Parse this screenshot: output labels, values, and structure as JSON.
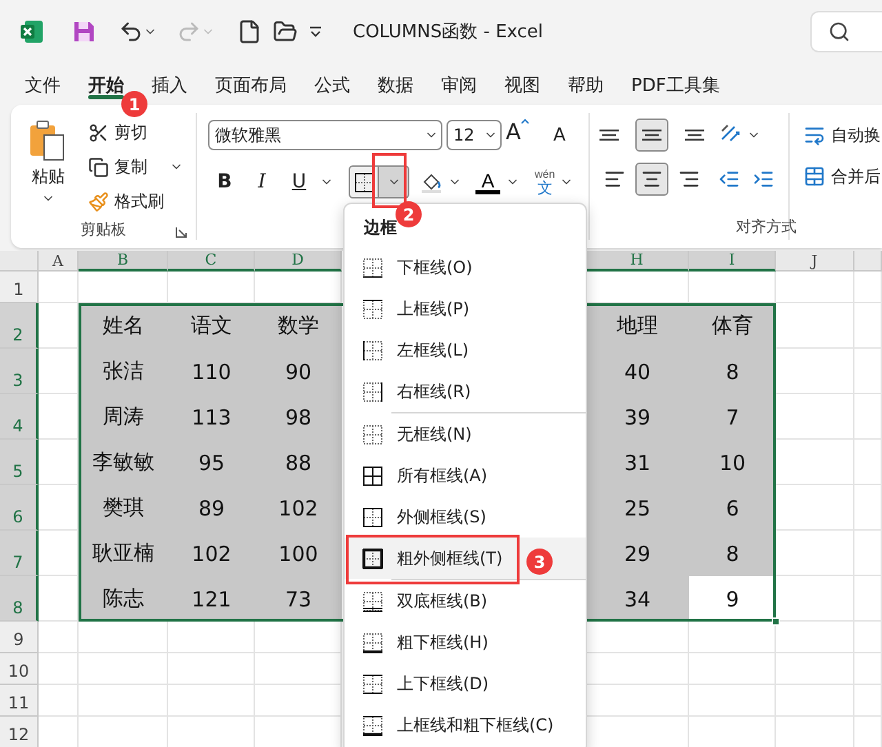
{
  "title_bar": {
    "title": "COLUMNS函数  -  Excel",
    "redo_disabled": true
  },
  "tabs": [
    {
      "label": "文件",
      "selected": false
    },
    {
      "label": "开始",
      "selected": true
    },
    {
      "label": "插入",
      "selected": false
    },
    {
      "label": "页面布局",
      "selected": false
    },
    {
      "label": "公式",
      "selected": false
    },
    {
      "label": "数据",
      "selected": false
    },
    {
      "label": "审阅",
      "selected": false
    },
    {
      "label": "视图",
      "selected": false
    },
    {
      "label": "帮助",
      "selected": false
    },
    {
      "label": "PDF工具集",
      "selected": false
    }
  ],
  "ribbon": {
    "clipboard": {
      "paste": "粘贴",
      "cut": "剪切",
      "copy": "复制",
      "format_painter": "格式刷",
      "label": "剪贴板"
    },
    "font": {
      "font_name": "微软雅黑",
      "font_size": "12",
      "grow": "A",
      "shrink": "A",
      "bold": "B",
      "italic": "I",
      "underline": "U",
      "font_color": "A",
      "phonetic_top": "wén",
      "phonetic_bottom": "文",
      "border_dropdown_pressed": true
    },
    "alignment": {
      "label": "对齐方式",
      "wrap_text": "自动换",
      "merge": "合并后",
      "vertical_align": [
        {
          "selected": false
        },
        {
          "selected": true
        },
        {
          "selected": false
        }
      ],
      "horizontal_align": [
        {
          "selected": false
        },
        {
          "selected": true
        },
        {
          "selected": false
        }
      ]
    }
  },
  "sheet": {
    "columns": [
      {
        "label": "A",
        "selected": false
      },
      {
        "label": "B",
        "selected": true
      },
      {
        "label": "C",
        "selected": true
      },
      {
        "label": "D",
        "selected": true
      },
      {
        "label": "H",
        "selected": true
      },
      {
        "label": "I",
        "selected": true
      },
      {
        "label": "J",
        "selected": false
      }
    ],
    "rows": [
      {
        "number": "1",
        "selected": false
      },
      {
        "number": "2",
        "selected": true
      },
      {
        "number": "3",
        "selected": true
      },
      {
        "number": "4",
        "selected": true
      },
      {
        "number": "5",
        "selected": true
      },
      {
        "number": "6",
        "selected": true
      },
      {
        "number": "7",
        "selected": true
      },
      {
        "number": "8",
        "selected": true
      },
      {
        "number": "9",
        "selected": false
      },
      {
        "number": "10",
        "selected": false
      },
      {
        "number": "11",
        "selected": false
      },
      {
        "number": "12",
        "selected": false
      }
    ],
    "table": [
      [
        {
          "text": "姓名",
          "active": false
        },
        {
          "text": "语文",
          "active": false
        },
        {
          "text": "数学",
          "active": false
        },
        {
          "text": "地理",
          "active": false
        },
        {
          "text": "体育",
          "active": false
        }
      ],
      [
        {
          "text": "张洁",
          "active": false
        },
        {
          "text": "110",
          "active": false
        },
        {
          "text": "90",
          "active": false
        },
        {
          "text": "40",
          "active": false
        },
        {
          "text": "8",
          "active": false
        }
      ],
      [
        {
          "text": "周涛",
          "active": false
        },
        {
          "text": "113",
          "active": false
        },
        {
          "text": "98",
          "active": false
        },
        {
          "text": "39",
          "active": false
        },
        {
          "text": "7",
          "active": false
        }
      ],
      [
        {
          "text": "李敏敏",
          "active": false
        },
        {
          "text": "95",
          "active": false
        },
        {
          "text": "88",
          "active": false
        },
        {
          "text": "31",
          "active": false
        },
        {
          "text": "10",
          "active": false
        }
      ],
      [
        {
          "text": "樊琪",
          "active": false
        },
        {
          "text": "89",
          "active": false
        },
        {
          "text": "102",
          "active": false
        },
        {
          "text": "25",
          "active": false
        },
        {
          "text": "6",
          "active": false
        }
      ],
      [
        {
          "text": "耿亚楠",
          "active": false
        },
        {
          "text": "102",
          "active": false
        },
        {
          "text": "100",
          "active": false
        },
        {
          "text": "29",
          "active": false
        },
        {
          "text": "8",
          "active": false
        }
      ],
      [
        {
          "text": "陈志",
          "active": false
        },
        {
          "text": "121",
          "active": false
        },
        {
          "text": "73",
          "active": false
        },
        {
          "text": "34",
          "active": false
        },
        {
          "text": "9",
          "active": true
        }
      ]
    ]
  },
  "border_menu": {
    "title": "边框",
    "sections": [
      [
        {
          "label": "下框线(O)",
          "kind": "bottom",
          "selected": false
        },
        {
          "label": "上框线(P)",
          "kind": "top",
          "selected": false
        },
        {
          "label": "左框线(L)",
          "kind": "left",
          "selected": false
        },
        {
          "label": "右框线(R)",
          "kind": "right",
          "selected": false
        }
      ],
      [
        {
          "label": "无框线(N)",
          "kind": "none",
          "selected": false
        },
        {
          "label": "所有框线(A)",
          "kind": "all",
          "selected": false
        },
        {
          "label": "外侧框线(S)",
          "kind": "outside",
          "selected": false
        },
        {
          "label": "粗外侧框线(T)",
          "kind": "thick_outside",
          "selected": true
        }
      ],
      [
        {
          "label": "双底框线(B)",
          "kind": "double_bottom",
          "selected": false
        },
        {
          "label": "粗下框线(H)",
          "kind": "thick_bottom",
          "selected": false
        },
        {
          "label": "上下框线(D)",
          "kind": "top_bottom",
          "selected": false
        },
        {
          "label": "上框线和粗下框线(C)",
          "kind": "top_thick_bottom",
          "selected": false
        }
      ]
    ]
  },
  "callouts": [
    "1",
    "2",
    "3"
  ]
}
